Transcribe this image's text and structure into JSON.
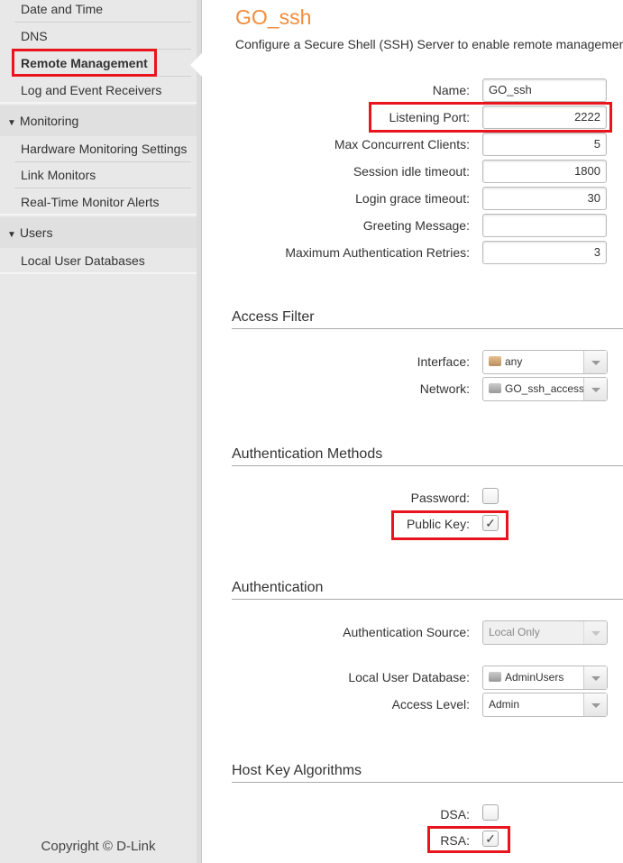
{
  "sidebar": {
    "items_top": [
      {
        "label": "Date and Time"
      },
      {
        "label": "DNS"
      },
      {
        "label": "Remote Management",
        "active": true
      },
      {
        "label": "Log and Event Receivers"
      }
    ],
    "groups": [
      {
        "label": "Monitoring",
        "items": [
          {
            "label": "Hardware Monitoring Settings"
          },
          {
            "label": "Link Monitors"
          },
          {
            "label": "Real-Time Monitor Alerts"
          }
        ]
      },
      {
        "label": "Users",
        "items": [
          {
            "label": "Local User Databases"
          }
        ]
      }
    ],
    "copyright": "Copyright © D-Link"
  },
  "main": {
    "title": "GO_ssh",
    "description": "Configure a Secure Shell (SSH) Server to enable remote management",
    "fields": [
      {
        "label": "Name:",
        "value": "GO_ssh"
      },
      {
        "label": "Listening Port:",
        "value": "2222"
      },
      {
        "label": "Max Concurrent Clients:",
        "value": "5"
      },
      {
        "label": "Session idle timeout:",
        "value": "1800"
      },
      {
        "label": "Login grace timeout:",
        "value": "30"
      },
      {
        "label": "Greeting Message:",
        "value": ""
      },
      {
        "label": "Maximum Authentication Retries:",
        "value": "3"
      }
    ],
    "access_filter": {
      "title": "Access Filter",
      "interface": {
        "label": "Interface:",
        "value": "any"
      },
      "network": {
        "label": "Network:",
        "value": "GO_ssh_access"
      }
    },
    "auth_methods": {
      "title": "Authentication Methods",
      "password": {
        "label": "Password:",
        "checked": false
      },
      "public_key": {
        "label": "Public Key:",
        "checked": true
      }
    },
    "authentication": {
      "title": "Authentication",
      "source": {
        "label": "Authentication Source:",
        "value": "Local Only",
        "disabled": true
      },
      "database": {
        "label": "Local User Database:",
        "value": "AdminUsers"
      },
      "access_level": {
        "label": "Access Level:",
        "value": "Admin"
      }
    },
    "host_key": {
      "title": "Host Key Algorithms",
      "dsa": {
        "label": "DSA:",
        "checked": false
      },
      "rsa": {
        "label": "RSA:",
        "checked": true
      }
    },
    "check_glyph": "✓"
  },
  "colors": {
    "title": "#f28c3c",
    "highlight": "#e8141e"
  }
}
